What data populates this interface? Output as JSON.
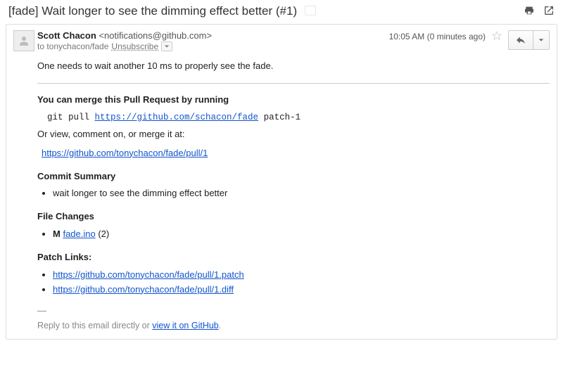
{
  "subject": "[fade] Wait longer to see the dimming effect better (#1)",
  "sender": {
    "name": "Scott Chacon",
    "email": "<notifications@github.com>"
  },
  "recipient_line": "to tonychacon/fade",
  "unsubscribe_label": "Unsubscribe",
  "timestamp": "10:05 AM (0 minutes ago)",
  "intro": "One needs to wait another 10 ms to properly see the fade.",
  "merge_heading": "You can merge this Pull Request by running",
  "git_cmd_pre": "git pull ",
  "git_cmd_url": "https://github.com/schacon/fade",
  "git_cmd_post": " patch-1",
  "or_line": "Or view, comment on, or merge it at:",
  "pr_url": "https://github.com/tonychacon/fade/pull/1",
  "commit_summary_heading": "Commit Summary",
  "commit_summary_item": "wait longer to see the dimming effect better",
  "file_changes_heading": "File Changes",
  "file_change_prefix": "M ",
  "file_change_name": "fade.ino",
  "file_change_count": " (2)",
  "patch_links_heading": "Patch Links:",
  "patch_link_1": "https://github.com/tonychacon/fade/pull/1.patch",
  "patch_link_2": "https://github.com/tonychacon/fade/pull/1.diff",
  "sig_dash": "—",
  "sig_text_pre": "Reply to this email directly or ",
  "sig_link": "view it on GitHub",
  "sig_text_post": "."
}
